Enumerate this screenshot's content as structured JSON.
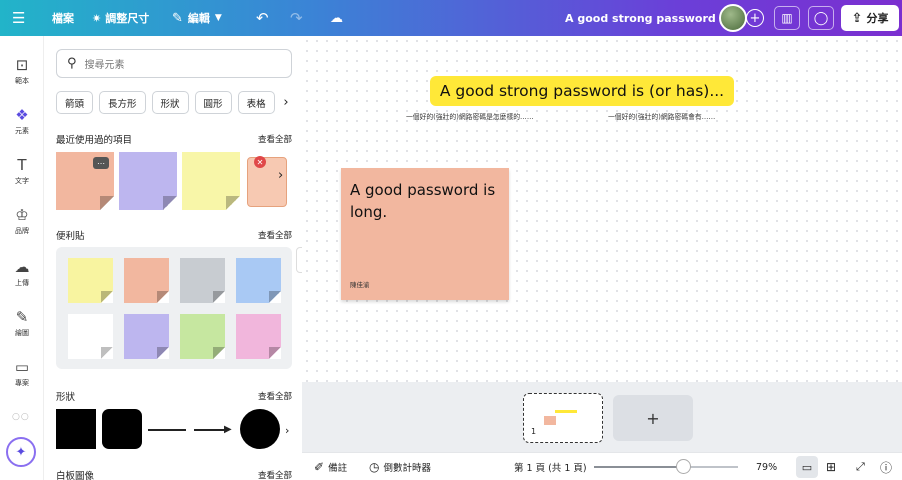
{
  "topbar": {
    "menu_icon": "☰",
    "file_label": "檔案",
    "resize_label": "調整尺寸",
    "edit_label": "編輯",
    "doc_title": "A good strong password is...",
    "share_label": "分享"
  },
  "rail": {
    "items": [
      {
        "icon": "template-icon",
        "glyph": "⊡",
        "label": "範本"
      },
      {
        "icon": "elements-icon",
        "glyph": "❖",
        "label": "元素"
      },
      {
        "icon": "text-icon",
        "glyph": "T",
        "label": "文字"
      },
      {
        "icon": "brand-icon",
        "glyph": "♔",
        "label": "品牌"
      },
      {
        "icon": "upload-icon",
        "glyph": "☁",
        "label": "上傳"
      },
      {
        "icon": "draw-icon",
        "glyph": "✎",
        "label": "繪圖"
      },
      {
        "icon": "projects-icon",
        "glyph": "▭",
        "label": "專案"
      }
    ]
  },
  "panel": {
    "search_placeholder": "搜尋元素",
    "chips": [
      "箭頭",
      "長方形",
      "形狀",
      "圓形",
      "表格"
    ],
    "recent_title": "最近使用過的項目",
    "sticky_title": "便利貼",
    "shapes_title": "形狀",
    "whiteboard_title": "白板圖像",
    "see_all": "查看全部",
    "recent_colors": [
      "#f2b79f",
      "#bdb6ef",
      "#f8f6a8"
    ],
    "sticky_colors": [
      "#f8f4a0",
      "#f2b79f",
      "#c8ccd1",
      "#a9c9f4",
      "#ffffff",
      "#bdb6ef",
      "#c6e7a0",
      "#f1b6dc"
    ]
  },
  "canvas": {
    "title": "A good strong password is (or has)...",
    "subtitle_left": "一個好的(強壯的)網路密碼是怎麼樣的……",
    "subtitle_right": "一個好的(強壯的)網路密碼會有……",
    "note_text": "A good password is long.",
    "note_author": "陳佳渝"
  },
  "pages": {
    "current_number": "1",
    "add_label": "+"
  },
  "bottombar": {
    "notes_label": "備註",
    "timer_label": "倒數計時器",
    "page_indicator": "第 1 頁 (共 1 頁)",
    "zoom_level": "79%",
    "zoom_fraction": 0.62
  }
}
